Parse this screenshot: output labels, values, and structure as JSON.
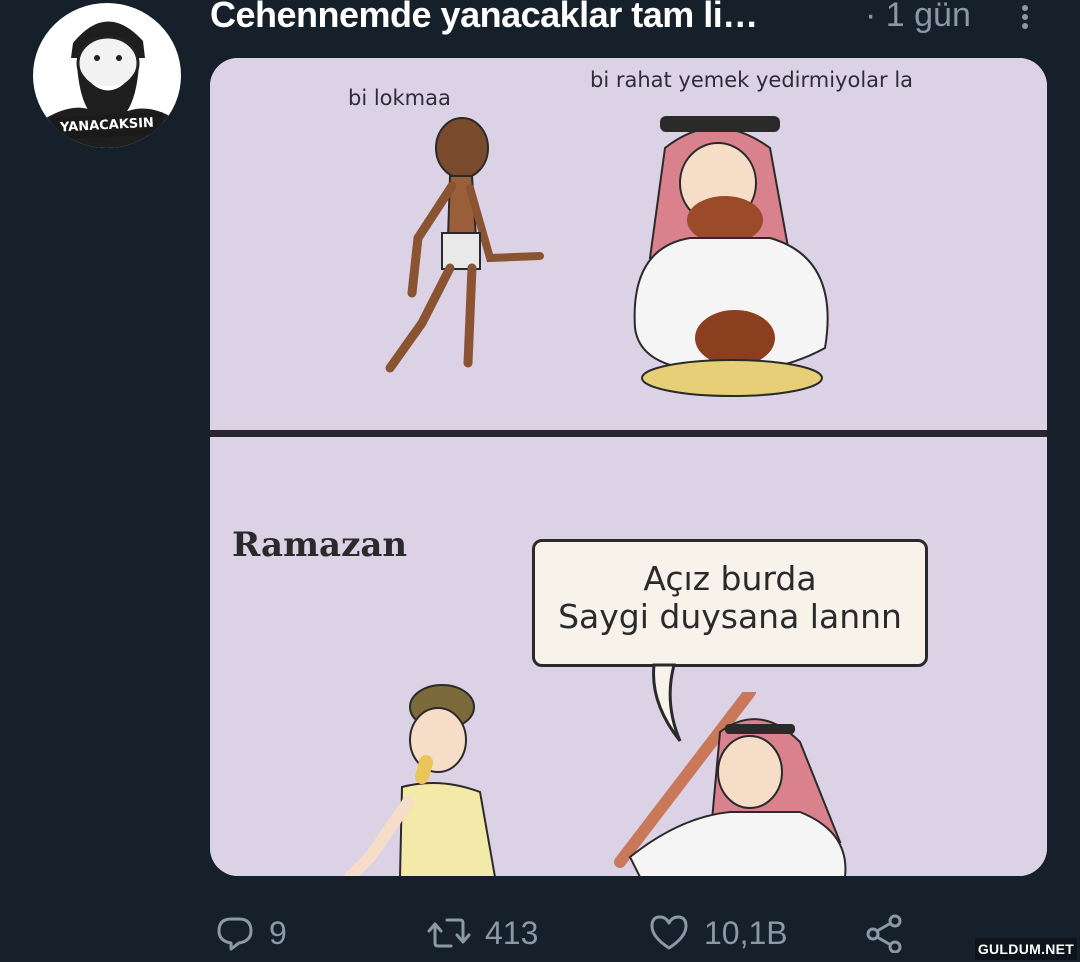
{
  "tweet": {
    "avatar_badge": "YANACAKSIN",
    "title": "Cehennemde yanacaklar tam li…",
    "time": "· 1 gün"
  },
  "media": {
    "top_panel": {
      "caption_left": "bi lokmaa",
      "caption_right": "bi rahat yemek yedirmiyolar la"
    },
    "bottom_panel": {
      "caption": "Ramazan",
      "bubble_lines": [
        "Açız burda",
        "Saygi duysana lannn"
      ]
    }
  },
  "actions": {
    "reply_count": "9",
    "retweet_count": "413",
    "like_count": "10,1B"
  },
  "watermark": "GULDUM.NET",
  "icons": {
    "reply": "reply-icon",
    "retweet": "retweet-icon",
    "like": "heart-icon",
    "share": "share-icon",
    "more": "more-vertical-icon"
  },
  "colors": {
    "background": "#15202b",
    "muted_text": "#8b98a5",
    "comic_background": "#dcd2e6"
  }
}
